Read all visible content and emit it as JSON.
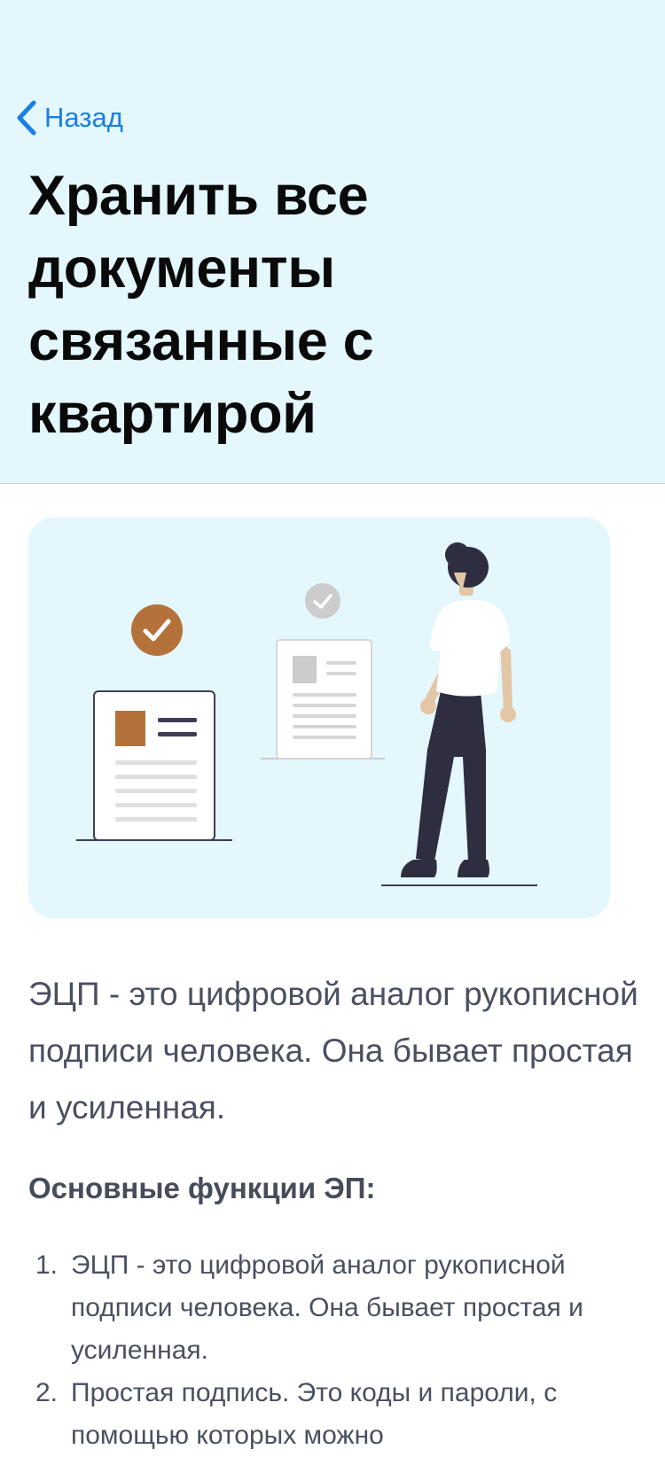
{
  "nav": {
    "back_label": "Назад"
  },
  "page": {
    "title": "Хранить все документы связанные с квартирой"
  },
  "illustration": {
    "colors": {
      "background": "#e3f7fd",
      "accent": "#b5713a",
      "dark": "#2f2e41"
    }
  },
  "content": {
    "intro": "ЭЦП - это цифровой аналог рукописной подписи человека. Она бывает простая и усиленная.",
    "functions_title": "Основные функции ЭП:",
    "functions": [
      {
        "num": "1.",
        "text": "ЭЦП - это цифровой аналог рукописной подписи человека. Она бывает простая и усиленная."
      },
      {
        "num": "2.",
        "text": "Простая подпись. Это коды и пароли, с помощью которых можно"
      }
    ]
  }
}
